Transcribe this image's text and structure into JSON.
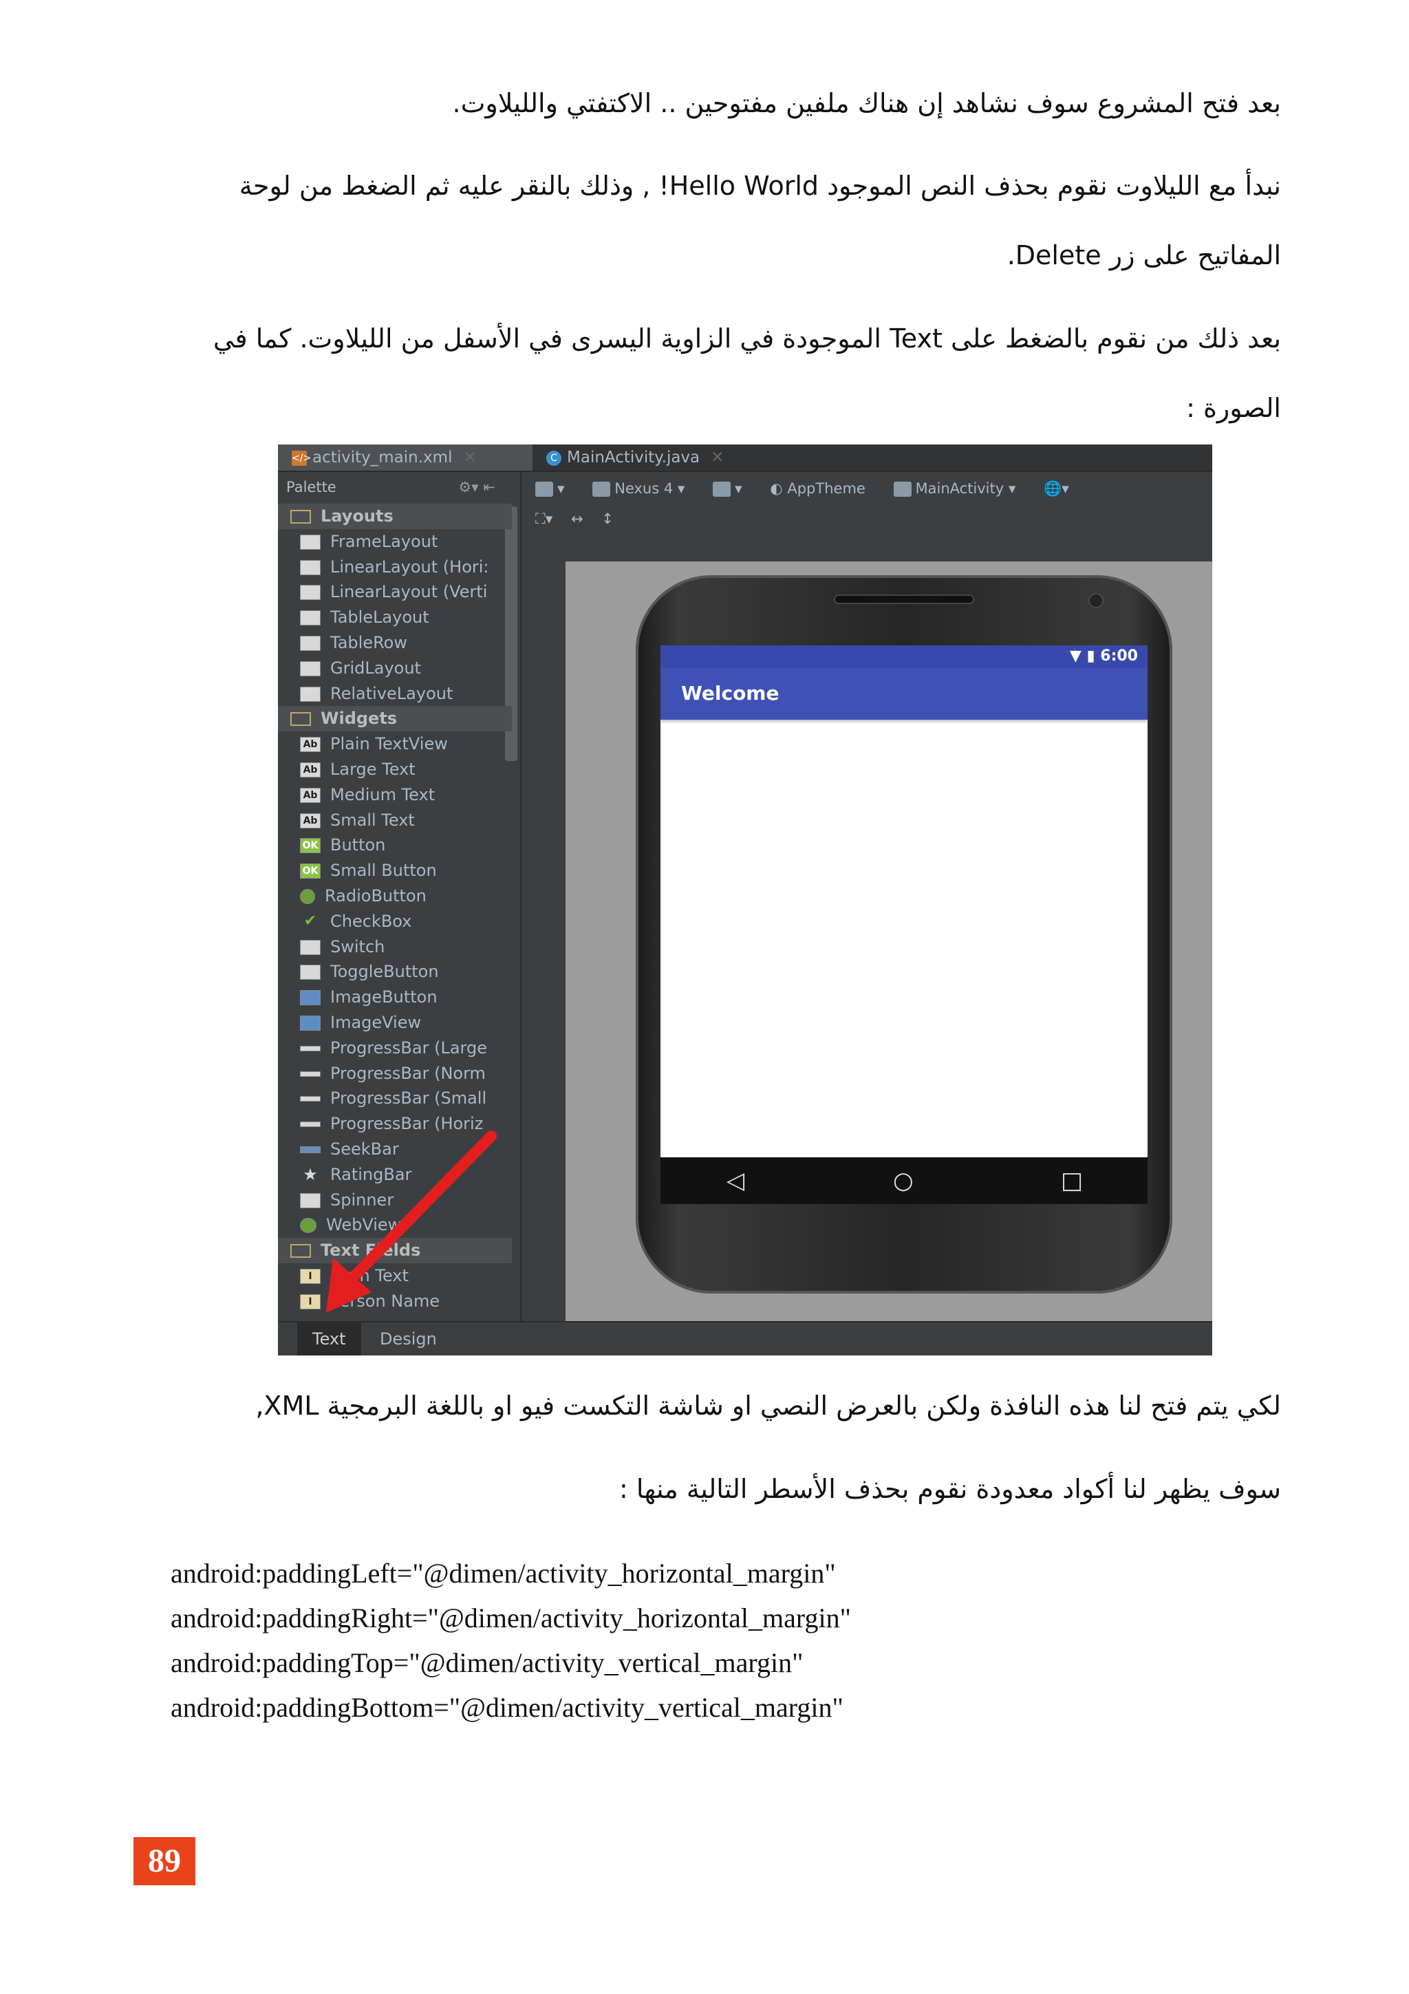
{
  "paragraphs": {
    "p1": "بعد فتح المشروع سوف نشاهد إن هناك ملفين مفتوحين .. الاكتفتي والليلاوت.",
    "p2_line1": "نبدأ مع الليلاوت نقوم بحذف النص الموجود Hello World! , وذلك بالنقر عليه ثم الضغط من لوحة",
    "p2_line2": "المفاتيح على زر Delete.",
    "p3_line1": "بعد ذلك من نقوم  بالضغط على Text الموجودة في الزاوية اليسرى في الأسفل من الليلاوت. كما في",
    "p3_line2": "الصورة :",
    "p4": "لكي يتم فتح لنا هذه النافذة ولكن بالعرض النصي او شاشة التكست فيو او باللغة البرمجية XML,",
    "p5": "سوف يظهر لنا أكواد معدودة نقوم بحذف الأسطر التالية منها :"
  },
  "code_lines": [
    "android:paddingLeft=\"@dimen/activity_horizontal_margin\"",
    "android:paddingRight=\"@dimen/activity_horizontal_margin\"",
    "android:paddingTop=\"@dimen/activity_vertical_margin\"",
    "android:paddingBottom=\"@dimen/activity_vertical_margin\""
  ],
  "page_number": "89",
  "screenshot": {
    "tabs": [
      "activity_main.xml",
      "MainActivity.java"
    ],
    "palette_title": "Palette",
    "categories": {
      "layouts": "Layouts",
      "widgets": "Widgets",
      "text_fields": "Text Fields"
    },
    "layouts": [
      "FrameLayout",
      "LinearLayout (Hori:",
      "LinearLayout (Verti",
      "TableLayout",
      "TableRow",
      "GridLayout",
      "RelativeLayout"
    ],
    "widgets": [
      "Plain TextView",
      "Large Text",
      "Medium Text",
      "Small Text",
      "Button",
      "Small Button",
      "RadioButton",
      "CheckBox",
      "Switch",
      "ToggleButton",
      "ImageButton",
      "ImageView",
      "ProgressBar (Large",
      "ProgressBar (Norm",
      "ProgressBar (Small",
      "ProgressBar (Horiz",
      "SeekBar",
      "RatingBar",
      "Spinner",
      "WebView"
    ],
    "text_fields": [
      "Plain Text",
      "Person Name"
    ],
    "toolbar": {
      "device": "Nexus 4",
      "theme": "AppTheme",
      "activity": "MainActivity"
    },
    "phone": {
      "time": "6:00",
      "app_title": "Welcome"
    },
    "bottom_tabs": [
      "Text",
      "Design"
    ]
  }
}
